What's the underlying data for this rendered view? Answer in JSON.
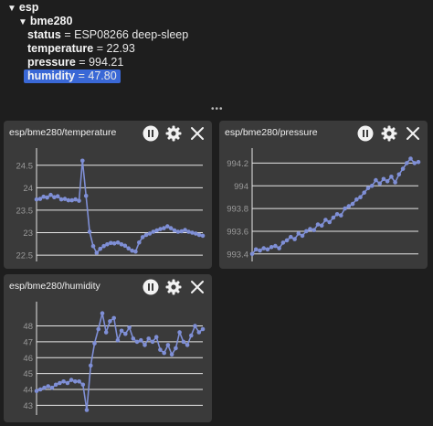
{
  "tree": {
    "root": {
      "name": "esp"
    },
    "device": {
      "name": "bme280"
    },
    "fields": [
      {
        "key": "status",
        "value": "ESP08266 deep-sleep"
      },
      {
        "key": "temperature",
        "value": "22.93"
      },
      {
        "key": "pressure",
        "value": "994.21"
      },
      {
        "key": "humidity",
        "value": "47.80",
        "selected": true
      }
    ],
    "eq": "="
  },
  "splitter": {
    "handle": "•••"
  },
  "panels": [
    {
      "title": "esp/bme280/temperature"
    },
    {
      "title": "esp/bme280/pressure"
    },
    {
      "title": "esp/bme280/humidity"
    }
  ],
  "icons": [
    "pause-icon",
    "gear-icon",
    "close-icon"
  ],
  "colors": {
    "series": "#7f8fd6",
    "accent": "#3a68d6",
    "grid": "#e6e6e6",
    "panel": "#3a3a3a",
    "background": "#1e1e1e"
  },
  "chart_data": [
    {
      "type": "line",
      "ylim": [
        22.4,
        24.8
      ],
      "yticks": [
        "22.5",
        "23",
        "23.5",
        "24",
        "24.5"
      ],
      "ytick_values": [
        22.5,
        23,
        23.5,
        24,
        24.5
      ],
      "values": [
        23.74,
        23.75,
        23.8,
        23.78,
        23.84,
        23.79,
        23.81,
        23.74,
        23.75,
        23.72,
        23.72,
        23.74,
        23.71,
        24.6,
        23.82,
        23.02,
        22.7,
        22.55,
        22.64,
        22.7,
        22.74,
        22.77,
        22.76,
        22.78,
        22.74,
        22.71,
        22.65,
        22.6,
        22.58,
        22.78,
        22.9,
        22.95,
        22.98,
        23.02,
        23.05,
        23.08,
        23.1,
        23.14,
        23.1,
        23.05,
        23.02,
        23.03,
        23.06,
        23.02,
        23.0,
        22.98,
        22.95,
        22.93
      ]
    },
    {
      "type": "line",
      "ylim": [
        993.35,
        994.3
      ],
      "yticks": [
        "993.4",
        "993.6",
        "993.8",
        "994",
        "994.2"
      ],
      "ytick_values": [
        993.4,
        993.6,
        993.8,
        994,
        994.2
      ],
      "values": [
        993.4,
        993.44,
        993.43,
        993.45,
        993.44,
        993.46,
        993.47,
        993.45,
        993.5,
        993.52,
        993.55,
        993.53,
        993.58,
        993.56,
        993.6,
        993.62,
        993.61,
        993.66,
        993.65,
        993.7,
        993.68,
        993.72,
        993.75,
        993.74,
        993.8,
        993.82,
        993.84,
        993.88,
        993.9,
        993.94,
        993.98,
        994.0,
        994.05,
        994.02,
        994.06,
        994.04,
        994.08,
        994.03,
        994.1,
        994.15,
        994.2,
        994.24,
        994.2,
        994.21
      ]
    },
    {
      "type": "line",
      "ylim": [
        42.5,
        49.3
      ],
      "yticks": [
        "43",
        "44",
        "45",
        "46",
        "47",
        "48"
      ],
      "ytick_values": [
        43,
        44,
        45,
        46,
        47,
        48
      ],
      "values": [
        43.9,
        44.0,
        44.1,
        44.2,
        44.1,
        44.3,
        44.4,
        44.5,
        44.4,
        44.6,
        44.5,
        44.5,
        44.3,
        42.7,
        45.5,
        46.9,
        47.8,
        48.8,
        47.6,
        48.3,
        48.5,
        47.1,
        47.7,
        47.5,
        47.9,
        47.2,
        47.0,
        47.1,
        46.8,
        47.2,
        47.0,
        47.3,
        46.5,
        46.3,
        46.8,
        46.2,
        46.6,
        47.6,
        47.0,
        46.8,
        47.4,
        48.0,
        47.6,
        47.8
      ]
    }
  ]
}
